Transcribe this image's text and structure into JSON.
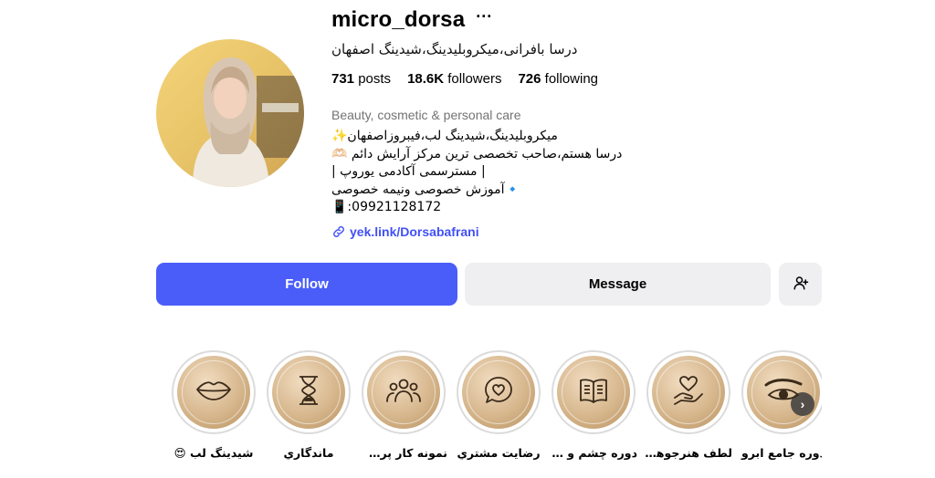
{
  "profile": {
    "username": "micro_dorsa",
    "more_icon": "···",
    "full_name": "درسا بافرانی،میکروبلیدینگ،شیدینگ اصفهان",
    "stats": {
      "posts_count": "731",
      "posts_label": "posts",
      "followers_count": "18.6K",
      "followers_label": "followers",
      "following_count": "726",
      "following_label": "following"
    },
    "category": "Beauty, cosmetic & personal care",
    "bio": [
      "میکروبلیدینگ،شیدینگ لب،فیبروزاصفهان✨",
      "درسا هستم،صاحب تخصصی ترین مرکز آرایش دائم 🫶🏻",
      "| مسترسمی آکادمی یوروپ |",
      "🔹آموزش خصوصی ونیمه خصوصی",
      "09921128172:📱"
    ],
    "link": "yek.link/Dorsabafrani"
  },
  "actions": {
    "follow_label": "Follow",
    "message_label": "Message"
  },
  "highlights": [
    {
      "label": "دوره جامع ابرو",
      "icon": "brow-icon"
    },
    {
      "label": "لطف هنرجوها...",
      "icon": "heart-hand-icon"
    },
    {
      "label": "دوره چشم و ل...",
      "icon": "book-icon"
    },
    {
      "label": "رضايت مشتري",
      "icon": "chat-heart-icon"
    },
    {
      "label": "نمونه کار پرسنل",
      "icon": "group-icon"
    },
    {
      "label": "ماندگاري",
      "icon": "hourglass-icon"
    },
    {
      "label": "شيدينگ لب 😍",
      "icon": "lips-icon"
    }
  ],
  "colors": {
    "accent": "#4a5df9",
    "link": "#4150f7",
    "secondary_button": "#efeff1",
    "muted_text": "#737373"
  }
}
